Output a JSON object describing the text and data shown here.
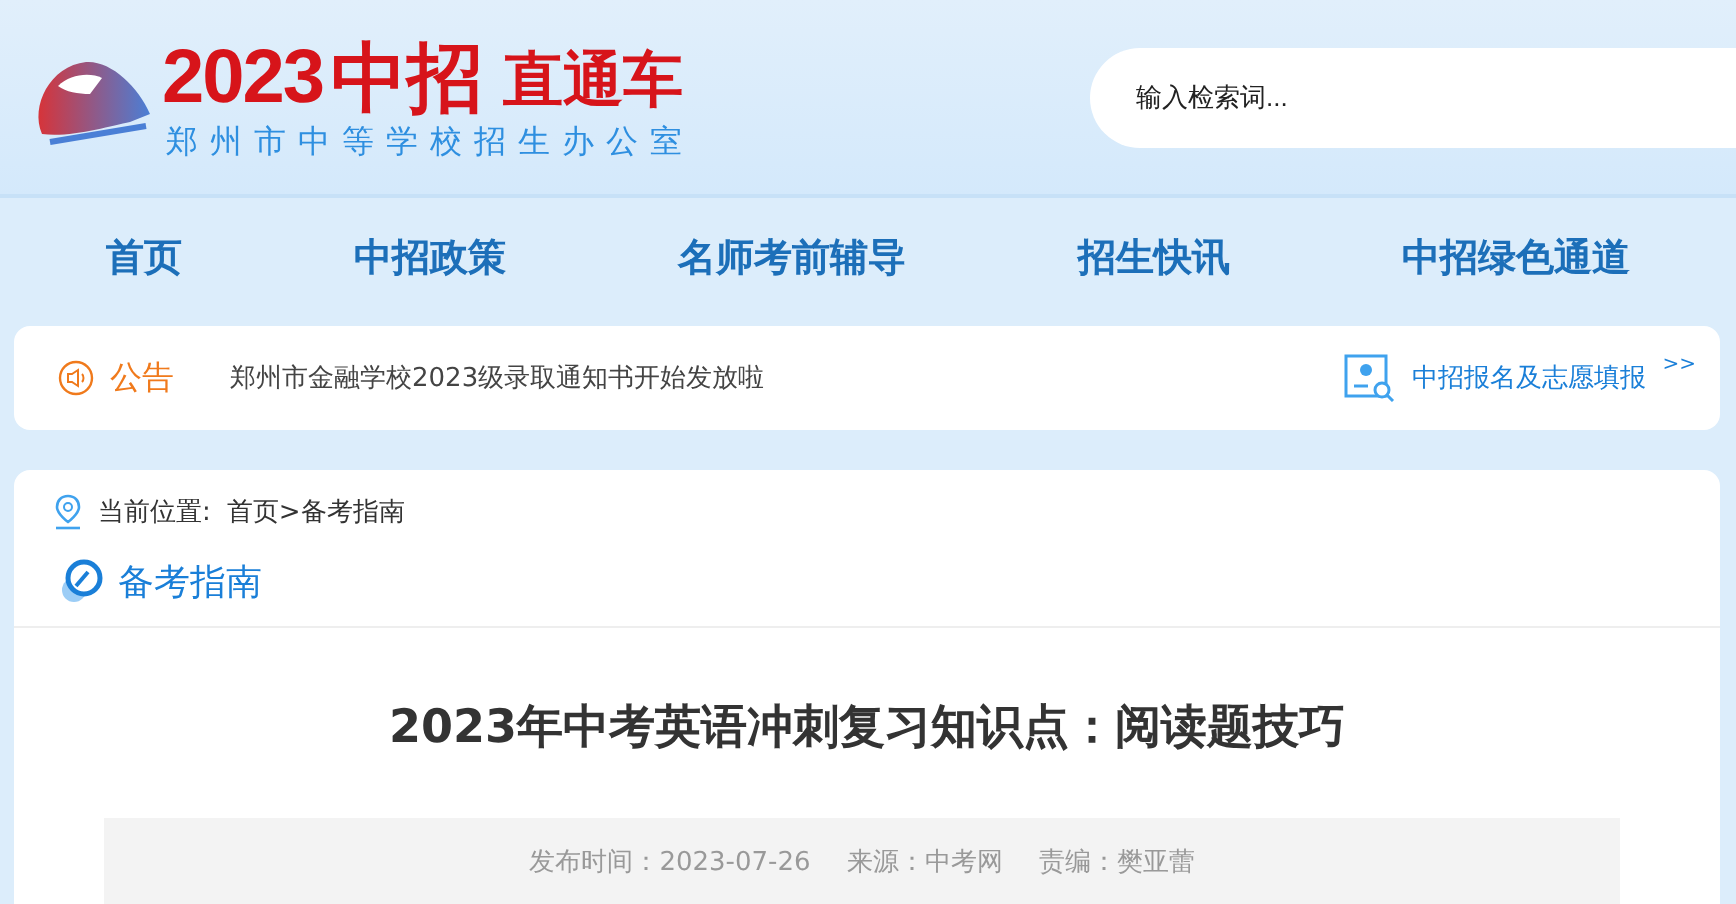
{
  "header": {
    "logo": {
      "year": "2023",
      "brand": "中招",
      "tagline": "直通车",
      "subtitle": "郑州市中等学校招生办公室"
    },
    "search": {
      "placeholder": "输入检索词..."
    }
  },
  "nav": [
    {
      "label": "首页",
      "selected": false
    },
    {
      "label": "中招政策",
      "selected": false
    },
    {
      "label": "名师考前辅导",
      "selected": false
    },
    {
      "label": "招生快讯",
      "selected": false
    },
    {
      "label": "中招绿色通道",
      "selected": false
    }
  ],
  "notice": {
    "label": "公告",
    "items": [
      "郑州市金融学校2023级录取通知书开始发放啦"
    ],
    "link": "中招报名及志愿填报",
    "more": ">>"
  },
  "breadcrumb": {
    "label": "当前位置:",
    "path": "首页>备考指南"
  },
  "section": {
    "title": "备考指南"
  },
  "article": {
    "title": "2023年中考英语冲刺复习知识点：阅读题技巧",
    "meta": [
      {
        "label": "发布时间：",
        "value": "2023-07-26"
      },
      {
        "label": "来源：",
        "value": "中考网"
      },
      {
        "label": "责编：",
        "value": "樊亚蕾"
      }
    ]
  }
}
